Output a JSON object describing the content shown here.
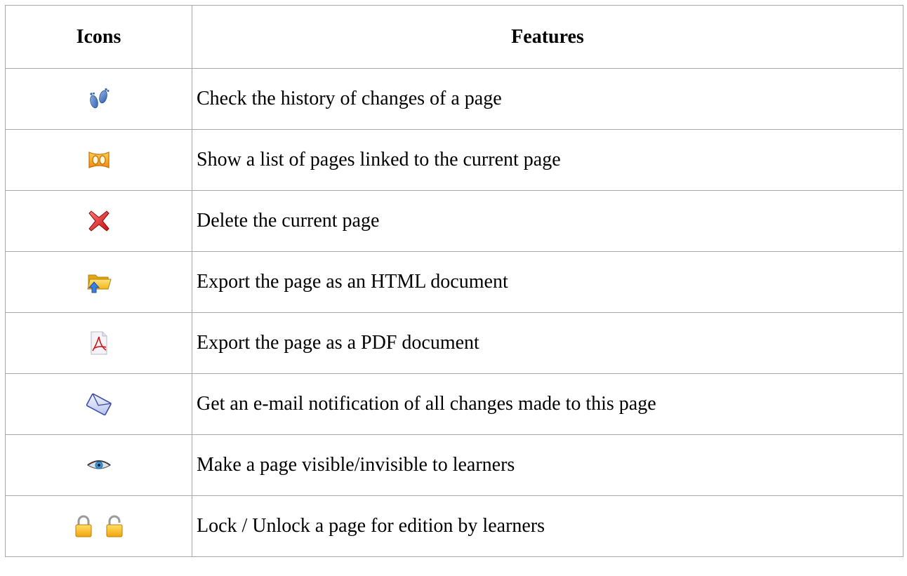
{
  "table": {
    "headers": {
      "icons": "Icons",
      "features": "Features"
    },
    "rows": [
      {
        "icon": "footprints-icon",
        "feature": "Check the history of changes of a page"
      },
      {
        "icon": "linked-pages-icon",
        "feature": "Show a list of pages linked to the current page"
      },
      {
        "icon": "delete-icon",
        "feature": "Delete the current page"
      },
      {
        "icon": "export-html-icon",
        "feature": "Export the page as an HTML document"
      },
      {
        "icon": "pdf-icon",
        "feature": "Export the page as a PDF document"
      },
      {
        "icon": "email-icon",
        "feature": "Get an e-mail notification of all changes made to this page"
      },
      {
        "icon": "eye-icon",
        "feature": "Make a page visible/invisible to learners"
      },
      {
        "icon": "lock-unlock-icons",
        "feature": "Lock / Unlock a page for edition by learners"
      }
    ]
  },
  "colors": {
    "border": "#a7a7a7",
    "text": "#000000",
    "background": "#ffffff"
  }
}
